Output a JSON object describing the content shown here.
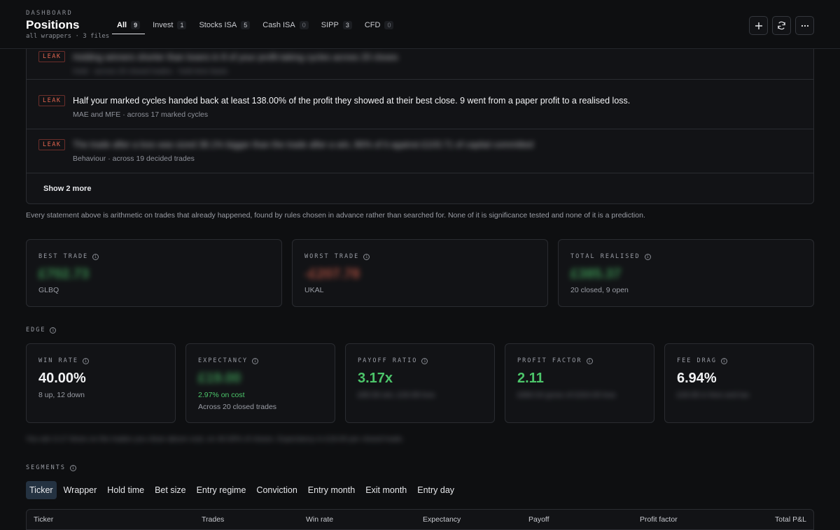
{
  "header": {
    "eyebrow": "DASHBOARD",
    "title": "Positions",
    "subtitle": "all wrappers · 3 files",
    "tabs": [
      {
        "label": "All",
        "count": "9"
      },
      {
        "label": "Invest",
        "count": "1"
      },
      {
        "label": "Stocks ISA",
        "count": "5"
      },
      {
        "label": "Cash ISA",
        "count": "0"
      },
      {
        "label": "SIPP",
        "count": "3"
      },
      {
        "label": "CFD",
        "count": "0"
      }
    ],
    "buttons": {
      "add": "+",
      "refresh": "⟳",
      "more": "⋯"
    }
  },
  "findings": {
    "items": [
      {
        "tag": "LEAK",
        "text": "Holding winners shorter than losers in 8 of your profit-taking cycles across 20 closes",
        "meta": "Hold · across 20 closed trades · hold time basis",
        "blurred": true
      },
      {
        "tag": "LEAK",
        "text": "Half your marked cycles handed back at least 138.00% of the profit they showed at their best close. 9 went from a paper profit to a realised loss.",
        "meta": "MAE and MFE · across 17 marked cycles",
        "blurred": false
      },
      {
        "tag": "LEAK",
        "text": "The trade after a loss was sized 38.1% bigger than the trade after a win, 86% of it against £103.71 of capital committed",
        "meta": "Behaviour · across 19 decided trades",
        "blurred": "text"
      }
    ],
    "show_more": "Show 2 more"
  },
  "disclaimer": "Every statement above is arithmetic on trades that already happened, found by rules chosen in advance rather than searched for. None of it is significance tested and none of it is a prediction.",
  "summary_cards": [
    {
      "label": "BEST TRADE",
      "value": "£702.73",
      "sub": "GLBQ",
      "tone": "green"
    },
    {
      "label": "WORST TRADE",
      "value": "-£207.78",
      "sub": "UKAL",
      "tone": "red"
    },
    {
      "label": "TOTAL REALISED",
      "value": "£385.37",
      "sub": "20 closed, 9 open",
      "tone": "green"
    }
  ],
  "edge": {
    "label": "EDGE",
    "cards": [
      {
        "label": "WIN RATE",
        "value": "40.00%",
        "sub": "8 up, 12 down",
        "sub2": "",
        "tone": "white",
        "blur_value": false,
        "blur_sub": false
      },
      {
        "label": "EXPECTANCY",
        "value": "£19.00",
        "sub": "2.97% on cost",
        "sub2": "Across 20 closed trades",
        "tone": "green",
        "blur_value": true,
        "blur_sub": false
      },
      {
        "label": "PAYOFF RATIO",
        "value": "3.17x",
        "sub": "£85.56 win, £26.99 loss",
        "sub2": "",
        "tone": "green",
        "blur_value": false,
        "blur_sub": true
      },
      {
        "label": "PROFIT FACTOR",
        "value": "2.11",
        "sub": "£684.54 gross of £324.00 loss",
        "sub2": "",
        "tone": "green",
        "blur_value": false,
        "blur_sub": true
      },
      {
        "label": "FEE DRAG",
        "value": "6.94%",
        "sub": "£26.95 in fees and tax",
        "sub2": "",
        "tone": "white",
        "blur_value": false,
        "blur_sub": true
      }
    ],
    "footnote": "You win 3.17 times on the trades you close above cost, on 40.00% of closes. Expectancy is £19.00 per closed trade."
  },
  "segments": {
    "label": "SEGMENTS",
    "tabs": [
      "Ticker",
      "Wrapper",
      "Hold time",
      "Bet size",
      "Entry regime",
      "Conviction",
      "Entry month",
      "Exit month",
      "Entry day"
    ],
    "active_tab": "Ticker",
    "columns": [
      "Ticker",
      "Trades",
      "Win rate",
      "Expectancy",
      "Payoff",
      "Profit factor",
      "Total P&L"
    ]
  },
  "colors": {
    "accent_green": "#4cc56a",
    "accent_red": "#e2654f",
    "background": "#0e0f11",
    "panel": "#121316"
  }
}
